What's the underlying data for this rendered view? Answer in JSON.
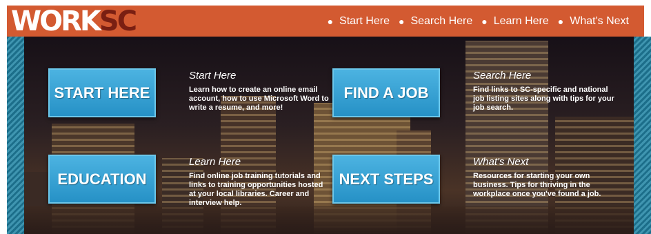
{
  "header": {
    "logo": {
      "part1": "WORK",
      "part2": "SC"
    },
    "nav": [
      {
        "label": "Start Here"
      },
      {
        "label": "Search Here"
      },
      {
        "label": "Learn Here"
      },
      {
        "label": "What's Next"
      }
    ]
  },
  "tiles": [
    {
      "button": "START HERE",
      "title": "Start Here",
      "text": "Learn how to create an online email account, how to use Microsoft Word to write a resume, and more!"
    },
    {
      "button": "FIND A JOB",
      "title": "Search Here",
      "text": "Find links to SC-specific and national job listing sites along with tips for your job search."
    },
    {
      "button": "EDUCATION",
      "title": "Learn Here",
      "text": "Find online job training tutorials and links to training opportunities hosted at your local libraries. Career and interview help."
    },
    {
      "button": "NEXT STEPS",
      "title": "What's Next",
      "text": "Resources for starting your own business. Tips for thriving in the workplace once you've found a job."
    }
  ],
  "colors": {
    "header": "#d35a31",
    "logo_accent": "#7a1f12",
    "button": "#2f9bd0",
    "stripe": "#1c6e8a"
  }
}
